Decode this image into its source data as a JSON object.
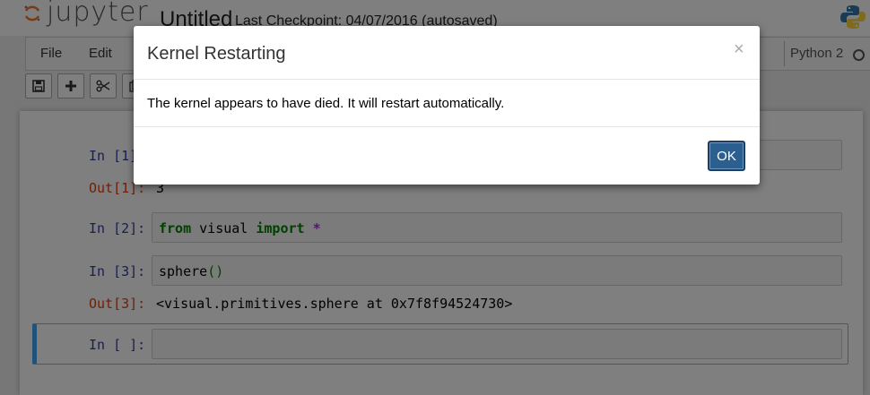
{
  "header": {
    "logo_text": "jupyter",
    "notebook_name": "Untitled",
    "checkpoint": "Last Checkpoint: 04/07/2016 (autosaved)"
  },
  "menubar": {
    "items": [
      "File",
      "Edit"
    ],
    "kernel_name": "Python 2"
  },
  "toolbar": {
    "buttons": [
      "save-icon",
      "plus-icon",
      "scissors-icon",
      "copy-icon"
    ]
  },
  "cells": [
    {
      "in_prompt": "In [1]:",
      "out_prompt": "Out[1]:",
      "output": "3"
    },
    {
      "in_prompt": "In [2]:",
      "code_parts": [
        "from",
        " visual ",
        "import",
        " *"
      ]
    },
    {
      "in_prompt": "In [3]:",
      "code_parts": [
        "sphere",
        "()"
      ],
      "out_prompt": "Out[3]:",
      "output": "<visual.primitives.sphere at 0x7f8f94524730>"
    },
    {
      "in_prompt": "In [ ]:"
    }
  ],
  "modal": {
    "title": "Kernel Restarting",
    "close": "×",
    "body": "The kernel appears to have died. It will restart automatically.",
    "ok_label": "OK"
  },
  "colors": {
    "in_prompt": "#303f9f",
    "out_prompt": "#d84315",
    "selected_cell_border": "#42a5f5",
    "ok_button": "#2b5f8f"
  }
}
